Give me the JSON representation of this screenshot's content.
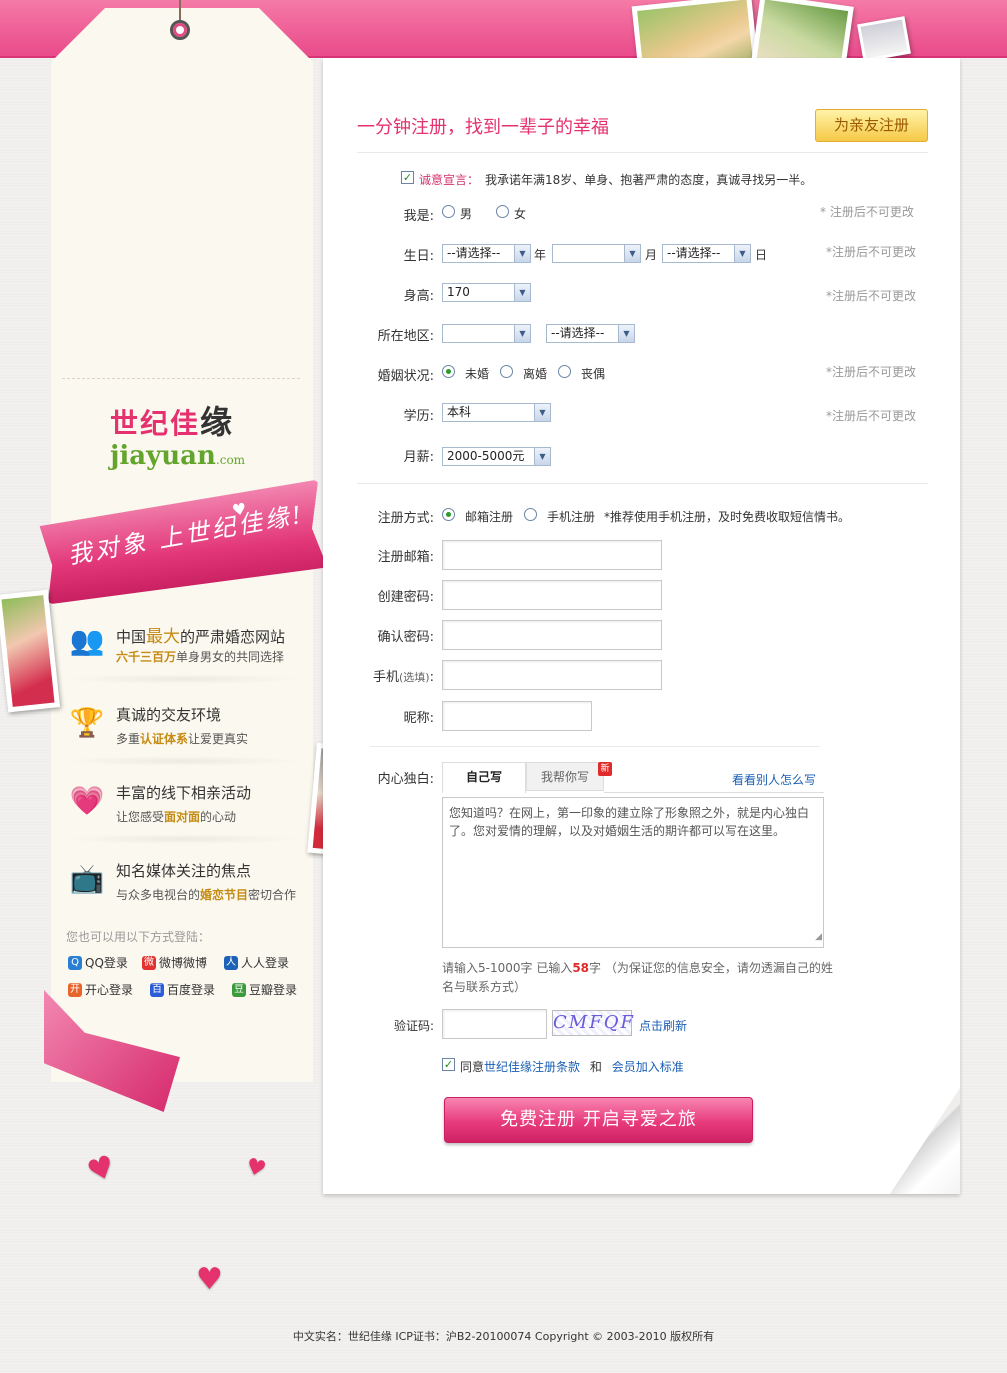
{
  "colors": {
    "brand_pink": "#e4326e",
    "gold": "#c58b14",
    "link": "#1a5fb4",
    "note": "#999999"
  },
  "sidebar": {
    "logo_cn_main": "世纪佳",
    "logo_cn_yuan": "缘",
    "logo_en": "jiayuan",
    "logo_en_suffix": ".com",
    "slogan": "我对象  上世纪佳缘!",
    "features": [
      {
        "title_pre": "中国",
        "title_em": "最大",
        "title_post": "的严肃婚恋网站",
        "sub_em": "六千三百万",
        "sub_post": "单身男女的共同选择",
        "icon": "people-icon"
      },
      {
        "title": "真诚的交友环境",
        "sub_pre": "多重",
        "sub_em": "认证体系",
        "sub_post": "让爱更真实",
        "icon": "trophy-icon"
      },
      {
        "title": "丰富的线下相亲活动",
        "sub_pre": "让您感受",
        "sub_em": "面对面",
        "sub_post": "的心动",
        "icon": "hi-heart-icon"
      },
      {
        "title": "知名媒体关注的焦点",
        "sub_pre": "与众多电视台的",
        "sub_em": "婚恋节目",
        "sub_post": "密切合作",
        "icon": "tv-icon"
      }
    ],
    "alt_login_title": "您也可以用以下方式登陆：",
    "alt_logins": [
      {
        "label": "QQ登录",
        "icon": "qq-icon",
        "color": "#2a7fd4",
        "glyph": "Q"
      },
      {
        "label": "微博微博",
        "icon": "weibo-icon",
        "color": "#e2322e",
        "glyph": "微"
      },
      {
        "label": "人人登录",
        "icon": "renren-icon",
        "color": "#1d62b8",
        "glyph": "人"
      },
      {
        "label": "开心登录",
        "icon": "kaixin-icon",
        "color": "#e7652a",
        "glyph": "开"
      },
      {
        "label": "百度登录",
        "icon": "baidu-icon",
        "color": "#2d5cd8",
        "glyph": "百"
      },
      {
        "label": "豆瓣登录",
        "icon": "douban-icon",
        "color": "#3c9a3c",
        "glyph": "豆"
      }
    ]
  },
  "form": {
    "heading": "一分钟注册，找到一辈子的幸福",
    "friend_button": "为亲友注册",
    "pledge_label": "诚意宣言：",
    "pledge_text": "我承诺年满18岁、单身、抱著严肃的态度，真诚寻找另一半。",
    "gender_label": "我是:",
    "gender_options": [
      "男",
      "女"
    ],
    "note_fixed_1": "* 注册后不可更改",
    "note_fixed": "*注册后不可更改",
    "birthday_label": "生日:",
    "birth_year_value": "--请选择--",
    "year_unit": "年",
    "birth_month_value": "",
    "month_unit": "月",
    "birth_day_value": "--请选择--",
    "day_unit": "日",
    "height_label": "身高:",
    "height_value": "170",
    "region_label": "所在地区:",
    "region_province_value": "",
    "region_city_value": "--请选择--",
    "marital_label": "婚姻状况:",
    "marital_options": [
      "未婚",
      "离婚",
      "丧偶"
    ],
    "education_label": "学历:",
    "education_value": "本科",
    "salary_label": "月薪:",
    "salary_value": "2000-5000元",
    "reg_method_label": "注册方式:",
    "reg_methods": [
      "邮箱注册",
      "手机注册"
    ],
    "reg_method_note": "*推荐使用手机注册，及时免费收取短信情书。",
    "email_label": "注册邮箱:",
    "password_label": "创建密码:",
    "confirm_label": "确认密码:",
    "phone_label": "手机",
    "phone_optional": "(选填)",
    "nickname_label": "昵称:",
    "monologue_label": "内心独白:",
    "tab_self": "自己写",
    "tab_help": "我帮你写",
    "tab_new_badge": "新",
    "see_others": "看看别人怎么写",
    "monologue_text": "您知道吗？在网上，第一印象的建立除了形象照之外，就是内心独白了。您对爱情的理解，以及对婚姻生活的期许都可以写在这里。",
    "hint_pre": "请输入5-1000字  已输入",
    "hint_count": "58",
    "hint_post": "字 （为保证您的信息安全，请勿透漏自己的姓名与联系方式）",
    "captcha_label": "验证码:",
    "captcha_text": "CMFQF",
    "refresh": "点击刷新",
    "agree_pre": "同意",
    "agree_terms": "世纪佳缘注册条款",
    "agree_and": "和",
    "agree_member": "会员加入标准",
    "submit": "免费注册  开启寻爱之旅"
  },
  "footer": {
    "text": "中文实名：世纪佳缘 ICP证书：沪B2-20100074 Copyright © 2003-2010 版权所有"
  }
}
